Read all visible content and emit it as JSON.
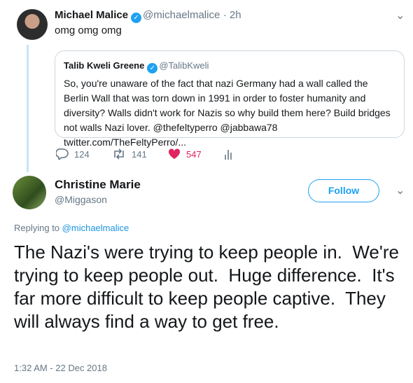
{
  "tweet": {
    "author_name": "Michael Malice",
    "author_handle": "@michaelmalice",
    "time": "· 2h",
    "text": "omg omg omg",
    "quoted": {
      "author_name": "Talib Kweli Greene",
      "author_handle": "@TalibKweli",
      "text": "So, you're unaware of the fact that nazi Germany had a wall called the Berlin Wall that was torn down in 1991 in order to foster humanity and diversity? Walls didn't work for Nazis so why build them here? Build bridges not walls Nazi lover. @thefeltyperro @jabbawa78 twitter.com/TheFeltyPerro/..."
    },
    "actions": {
      "replies": "124",
      "retweets": "141",
      "likes": "547"
    }
  },
  "reply": {
    "author_name": "Christine Marie",
    "author_handle": "@Miggason",
    "follow_label": "Follow",
    "replying_prefix": "Replying to",
    "replying_to": "@michaelmalice",
    "text": "The Nazi's were trying to keep people in.  We're trying to keep people out.  Huge difference.  It's far more difficult to keep people captive.  They will always find a way to get free.",
    "timestamp": "1:32 AM - 22 Dec 2018"
  },
  "colors": {
    "accent": "#1da1f2",
    "like": "#e0245e",
    "muted": "#657786"
  },
  "icons": [
    "verified-badge-icon",
    "chevron-down-icon",
    "reply-icon",
    "retweet-icon",
    "heart-icon",
    "analytics-icon"
  ]
}
